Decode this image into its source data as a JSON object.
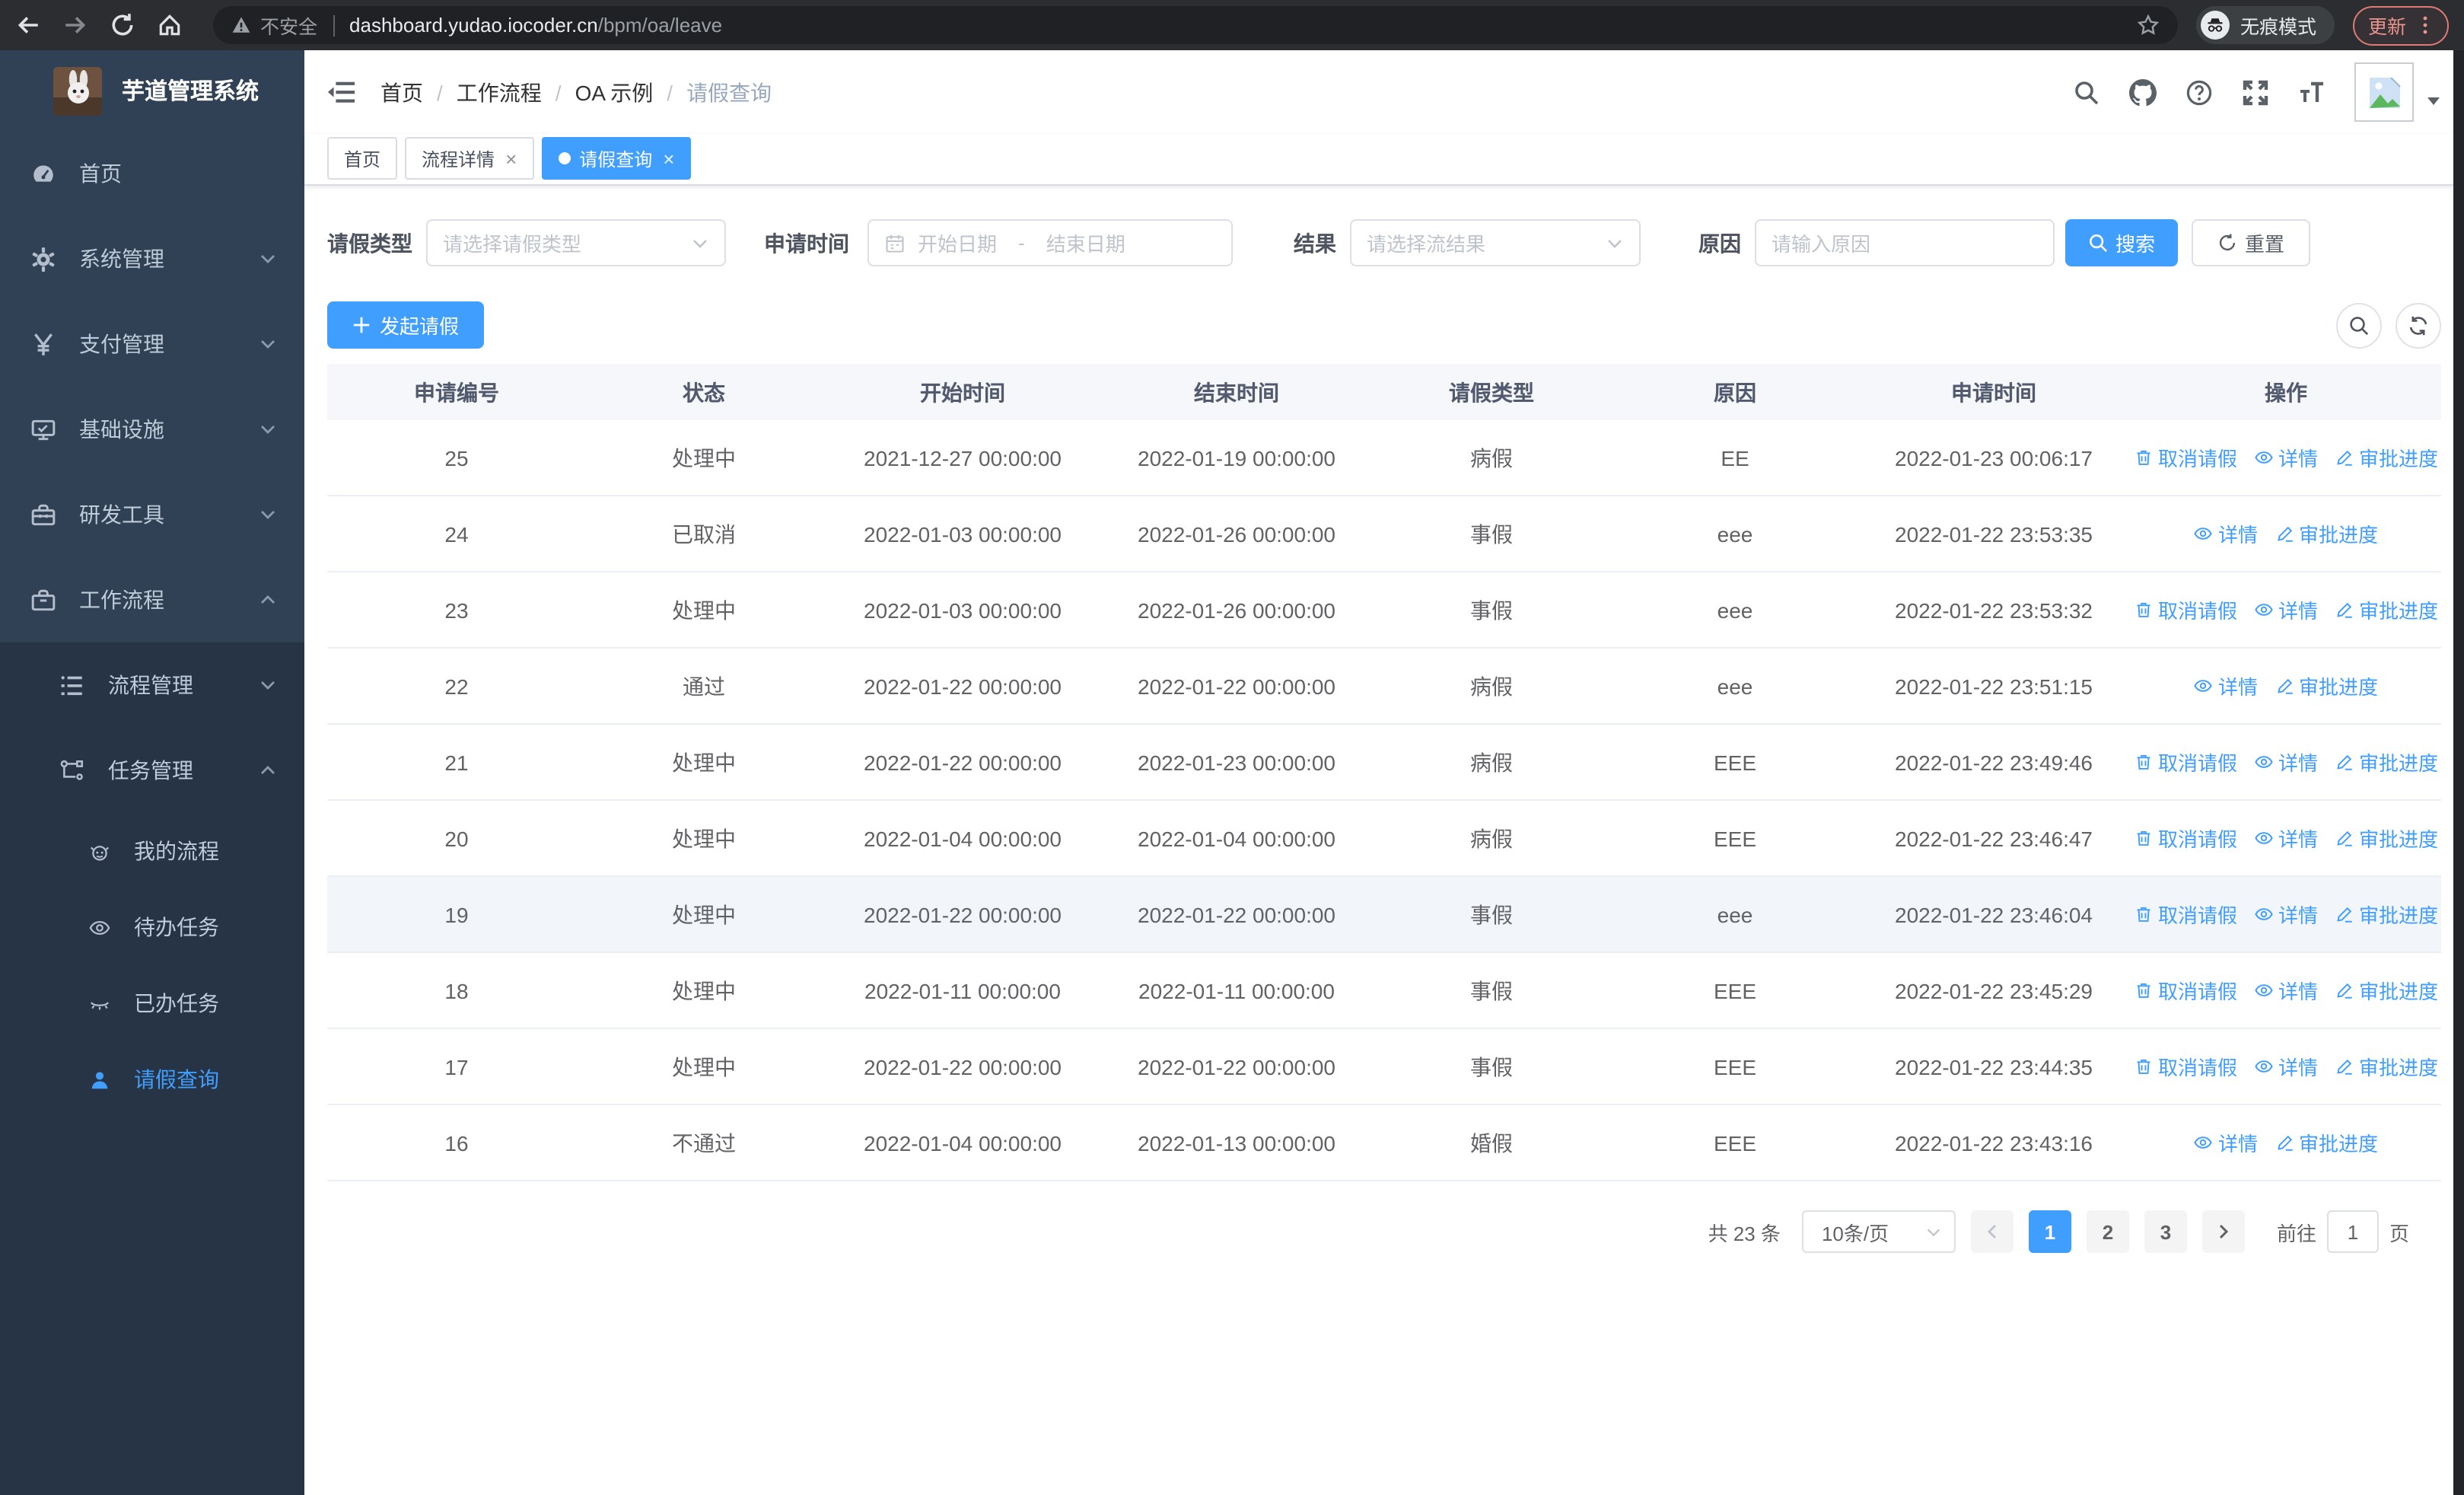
{
  "browser": {
    "insecure_label": "不安全",
    "url_host": "dashboard.yudao.iocoder.cn",
    "url_path": "/bpm/oa/leave",
    "incognito_label": "无痕模式",
    "update_label": "更新"
  },
  "colors": {
    "primary": "#409EFF",
    "sidebar_bg": "#304156",
    "sidebar_submenu_bg": "#263445",
    "sidebar_text": "#bfcbd9",
    "update_accent": "#df7b72",
    "table_header_bg": "#f5f7fa"
  },
  "sidebar": {
    "title": "芋道管理系统",
    "items": [
      {
        "label": "首页"
      },
      {
        "label": "系统管理"
      },
      {
        "label": "支付管理"
      },
      {
        "label": "基础设施"
      },
      {
        "label": "研发工具"
      },
      {
        "label": "工作流程"
      }
    ],
    "submenu": [
      {
        "label": "流程管理"
      },
      {
        "label": "任务管理"
      }
    ],
    "tasks": [
      {
        "label": "我的流程"
      },
      {
        "label": "待办任务"
      },
      {
        "label": "已办任务"
      },
      {
        "label": "请假查询"
      }
    ]
  },
  "breadcrumb": [
    "首页",
    "工作流程",
    "OA 示例",
    "请假查询"
  ],
  "tabs": [
    {
      "label": "首页"
    },
    {
      "label": "流程详情"
    },
    {
      "label": "请假查询"
    }
  ],
  "filters": {
    "leave_type_label": "请假类型",
    "leave_type_placeholder": "请选择请假类型",
    "apply_time_label": "申请时间",
    "date_start_placeholder": "开始日期",
    "date_separator": "-",
    "date_end_placeholder": "结束日期",
    "result_label": "结果",
    "result_placeholder": "请选择流结果",
    "reason_label": "原因",
    "reason_placeholder": "请输入原因",
    "search_label": "搜索",
    "reset_label": "重置"
  },
  "toolbar": {
    "create_label": "发起请假"
  },
  "table": {
    "columns": [
      "申请编号",
      "状态",
      "开始时间",
      "结束时间",
      "请假类型",
      "原因",
      "申请时间",
      "操作"
    ],
    "action_labels": {
      "cancel": "取消请假",
      "detail": "详情",
      "progress": "审批进度"
    },
    "rows": [
      {
        "id": "25",
        "status": "处理中",
        "start": "2021-12-27 00:00:00",
        "end": "2022-01-19 00:00:00",
        "type": "病假",
        "reason": "EE",
        "applied": "2022-01-23 00:06:17",
        "actions": [
          "cancel",
          "detail",
          "progress"
        ],
        "highlighted": false
      },
      {
        "id": "24",
        "status": "已取消",
        "start": "2022-01-03 00:00:00",
        "end": "2022-01-26 00:00:00",
        "type": "事假",
        "reason": "eee",
        "applied": "2022-01-22 23:53:35",
        "actions": [
          "detail",
          "progress"
        ],
        "highlighted": false
      },
      {
        "id": "23",
        "status": "处理中",
        "start": "2022-01-03 00:00:00",
        "end": "2022-01-26 00:00:00",
        "type": "事假",
        "reason": "eee",
        "applied": "2022-01-22 23:53:32",
        "actions": [
          "cancel",
          "detail",
          "progress"
        ],
        "highlighted": false
      },
      {
        "id": "22",
        "status": "通过",
        "start": "2022-01-22 00:00:00",
        "end": "2022-01-22 00:00:00",
        "type": "病假",
        "reason": "eee",
        "applied": "2022-01-22 23:51:15",
        "actions": [
          "detail",
          "progress"
        ],
        "highlighted": false
      },
      {
        "id": "21",
        "status": "处理中",
        "start": "2022-01-22 00:00:00",
        "end": "2022-01-23 00:00:00",
        "type": "病假",
        "reason": "EEE",
        "applied": "2022-01-22 23:49:46",
        "actions": [
          "cancel",
          "detail",
          "progress"
        ],
        "highlighted": false
      },
      {
        "id": "20",
        "status": "处理中",
        "start": "2022-01-04 00:00:00",
        "end": "2022-01-04 00:00:00",
        "type": "病假",
        "reason": "EEE",
        "applied": "2022-01-22 23:46:47",
        "actions": [
          "cancel",
          "detail",
          "progress"
        ],
        "highlighted": false
      },
      {
        "id": "19",
        "status": "处理中",
        "start": "2022-01-22 00:00:00",
        "end": "2022-01-22 00:00:00",
        "type": "事假",
        "reason": "eee",
        "applied": "2022-01-22 23:46:04",
        "actions": [
          "cancel",
          "detail",
          "progress"
        ],
        "highlighted": true
      },
      {
        "id": "18",
        "status": "处理中",
        "start": "2022-01-11 00:00:00",
        "end": "2022-01-11 00:00:00",
        "type": "事假",
        "reason": "EEE",
        "applied": "2022-01-22 23:45:29",
        "actions": [
          "cancel",
          "detail",
          "progress"
        ],
        "highlighted": false
      },
      {
        "id": "17",
        "status": "处理中",
        "start": "2022-01-22 00:00:00",
        "end": "2022-01-22 00:00:00",
        "type": "事假",
        "reason": "EEE",
        "applied": "2022-01-22 23:44:35",
        "actions": [
          "cancel",
          "detail",
          "progress"
        ],
        "highlighted": false
      },
      {
        "id": "16",
        "status": "不通过",
        "start": "2022-01-04 00:00:00",
        "end": "2022-01-13 00:00:00",
        "type": "婚假",
        "reason": "EEE",
        "applied": "2022-01-22 23:43:16",
        "actions": [
          "detail",
          "progress"
        ],
        "highlighted": false
      }
    ]
  },
  "pagination": {
    "total": "共 23 条",
    "page_size": "10条/页",
    "pages": [
      "1",
      "2",
      "3"
    ],
    "active_page": "1",
    "goto_label": "前往",
    "goto_value": "1",
    "unit_label": "页"
  }
}
